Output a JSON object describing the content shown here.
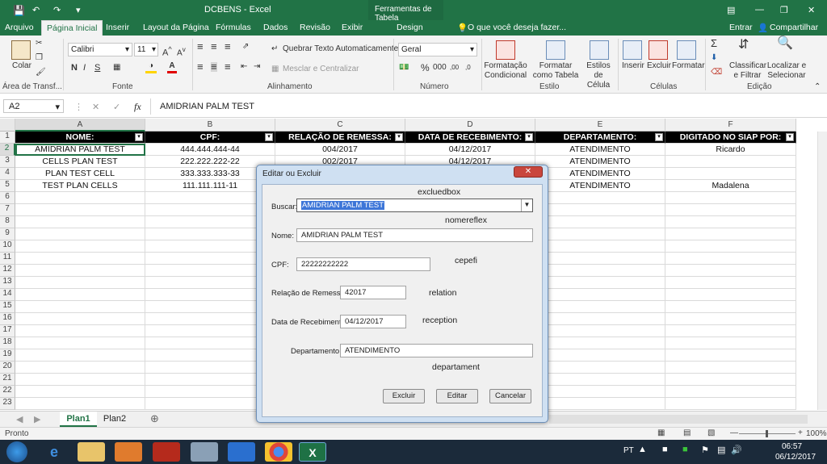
{
  "window": {
    "title": "DCBENS - Excel",
    "tool_tab": "Ferramentas de Tabela"
  },
  "menu": {
    "items": [
      "Arquivo",
      "Página Inicial",
      "Inserir",
      "Layout da Página",
      "Fórmulas",
      "Dados",
      "Revisão",
      "Exibir",
      "Design"
    ],
    "tell_me": "O que você deseja fazer...",
    "enter": "Entrar",
    "share": "Compartilhar"
  },
  "ribbon": {
    "paste": "Colar",
    "clipboard": "Área de Transf...",
    "font_name": "Calibri",
    "font_size": "11",
    "font_group": "Fonte",
    "wrap_text": "Quebrar Texto Automaticamente",
    "merge": "Mesclar e Centralizar",
    "align_group": "Alinhamento",
    "number_format": "Geral",
    "number_group": "Número",
    "cond_format": "Formatação Condicional",
    "format_table": "Formatar como Tabela",
    "cell_styles": "Estilos de Célula",
    "style_group": "Estilo",
    "insert": "Inserir",
    "delete": "Excluir",
    "format": "Formatar",
    "cells_group": "Células",
    "sort_filter": "Classificar e Filtrar",
    "find_select": "Localizar e Selecionar",
    "edit_group": "Edição"
  },
  "formula_bar": {
    "name_box": "A2",
    "fx": "fx",
    "value": "AMIDRIAN PALM TEST"
  },
  "sheet": {
    "columns": [
      "A",
      "B",
      "C",
      "D",
      "E",
      "F"
    ],
    "headers": [
      "NOME:",
      "CPF:",
      "RELAÇÃO DE REMESSA:",
      "DATA DE RECEBIMENTO:",
      "DEPARTAMENTO:",
      "DIGITADO NO SIAP POR:"
    ],
    "rows": [
      [
        "AMIDRIAN PALM TEST",
        "444.444.444-44",
        "004/2017",
        "04/12/2017",
        "ATENDIMENTO",
        "Ricardo"
      ],
      [
        "CELLS PLAN TEST",
        "222.222.222-22",
        "002/2017",
        "04/12/2017",
        "ATENDIMENTO",
        ""
      ],
      [
        "PLAN TEST CELL",
        "333.333.333-33",
        "",
        "",
        "ATENDIMENTO",
        ""
      ],
      [
        "TEST PLAN CELLS",
        "111.111.111-11",
        "",
        "",
        "ATENDIMENTO",
        "Madalena"
      ]
    ],
    "row_numbers": [
      "1",
      "2",
      "3",
      "4",
      "5",
      "6",
      "7",
      "8",
      "9",
      "10",
      "11",
      "12",
      "13",
      "14",
      "15",
      "16",
      "17",
      "18",
      "19",
      "20",
      "21",
      "22",
      "23"
    ]
  },
  "tabs": {
    "sheets": [
      "Plan1",
      "Plan2"
    ],
    "active": "Plan1"
  },
  "status": {
    "text": "Pronto",
    "zoom": "100%"
  },
  "taskbar": {
    "lang": "PT",
    "time": "06:57",
    "date": "06/12/2017"
  },
  "dialog": {
    "title": "Editar ou Excluir",
    "search_label": "Buscar:",
    "search_value": "AMIDRIAN PALM TEST",
    "name_label": "Nome:",
    "name_value": "AMIDRIAN PALM TEST",
    "cpf_label": "CPF:",
    "cpf_value": "22222222222",
    "relation_label": "Relação de Remessa:",
    "relation_value": "42017",
    "date_label": "Data de Recebimento:",
    "date_value": "04/12/2017",
    "dept_label": "Departamento:",
    "dept_value": "ATENDIMENTO",
    "tag_excluedbox": "excluedbox",
    "tag_nomereflex": "nomereflex",
    "tag_cepefi": "cepefi",
    "tag_relation": "relation",
    "tag_reception": "reception",
    "tag_departament": "departament",
    "btn_delete": "Excluir",
    "btn_edit": "Editar",
    "btn_cancel": "Cancelar"
  }
}
